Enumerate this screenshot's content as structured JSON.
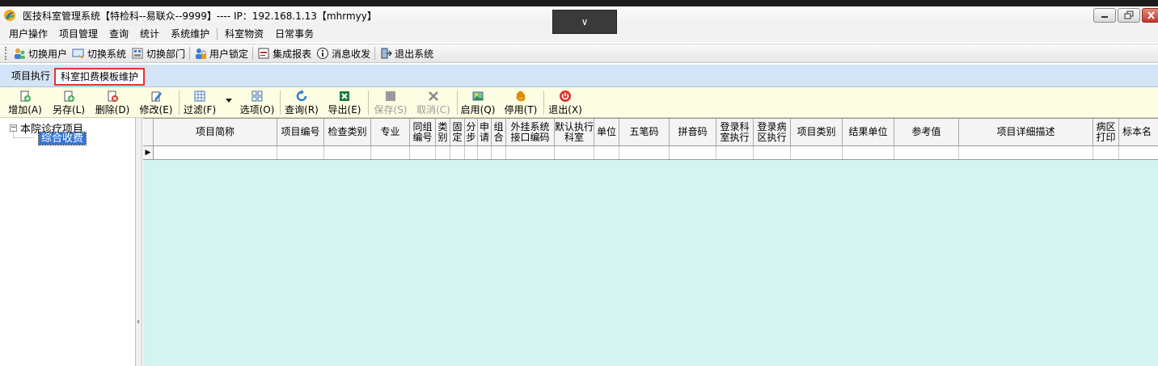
{
  "window": {
    "title": "医技科室管理系统【特检科--易联众--9999】---- IP：192.168.1.13【mhrmyy】",
    "dropdown_glyph": "∨"
  },
  "menubar": {
    "items": [
      "用户操作",
      "项目管理",
      "查询",
      "统计",
      "系统维护",
      "科室物资",
      "日常事务"
    ]
  },
  "toolbar1": {
    "items": [
      {
        "label": "切换用户",
        "icon": "switch-user-icon"
      },
      {
        "label": "切换系统",
        "icon": "switch-system-icon"
      },
      {
        "label": "切换部门",
        "icon": "switch-department-icon"
      },
      {
        "label": "用户锁定",
        "icon": "user-lock-icon"
      },
      {
        "label": "集成报表",
        "icon": "report-icon"
      },
      {
        "label": "消息收发",
        "icon": "message-icon"
      },
      {
        "label": "退出系统",
        "icon": "exit-icon"
      }
    ]
  },
  "tabs": {
    "exec": "项目执行",
    "template": "科室扣费模板维护"
  },
  "toolbar2": {
    "add": "增加(A)",
    "save_as": "另存(L)",
    "delete": "删除(D)",
    "edit": "修改(E)",
    "filter": "过滤(F)",
    "options": "选项(O)",
    "query": "查询(R)",
    "export": "导出(E)",
    "save": "保存(S)",
    "cancel": "取消(C)",
    "enable": "启用(Q)",
    "disable": "停用(T)",
    "exit": "退出(X)"
  },
  "tree": {
    "root": "本院诊疗项目",
    "child": "综合收费",
    "expander": "⊟"
  },
  "grid": {
    "columns": [
      "项目简称",
      "项目编号",
      "检查类别",
      "专业",
      "同组编号",
      "类别",
      "固定",
      "分步",
      "申请",
      "组合",
      "外挂系统接口编码",
      "默认执行科室",
      "单位",
      "五笔码",
      "拼音码",
      "登录科室执行",
      "登录病区执行",
      "项目类别",
      "结果单位",
      "参考值",
      "项目详细描述",
      "病区打印",
      "标本名"
    ],
    "row_indicator": "▶"
  }
}
